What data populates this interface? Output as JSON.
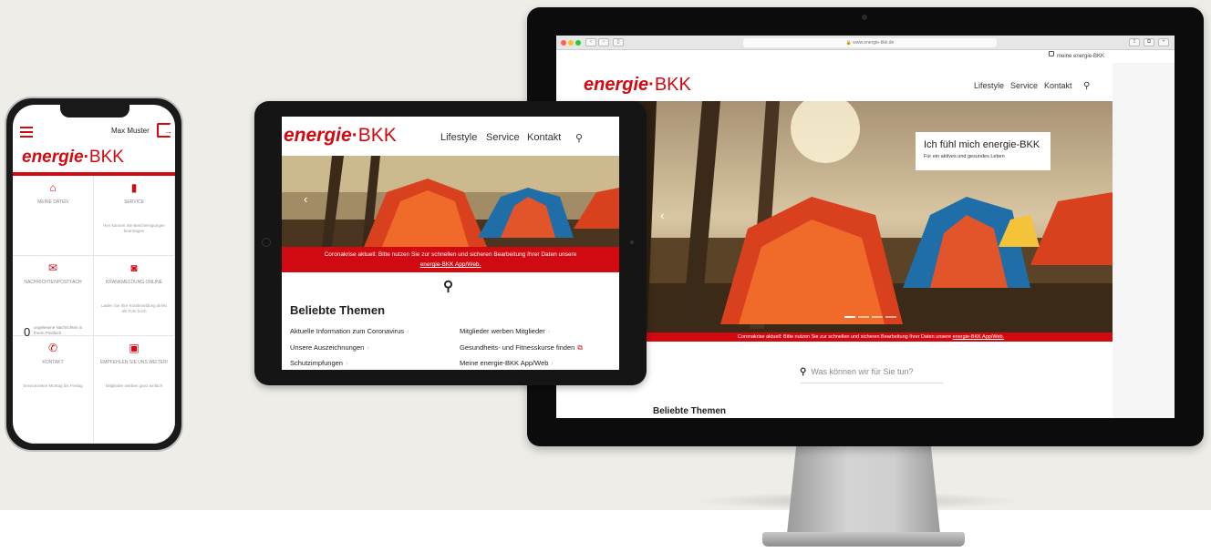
{
  "brand": {
    "logo_main": "energie",
    "logo_dot": "·",
    "logo_suffix": "BKK",
    "accent_color": "#d10a11"
  },
  "desktop": {
    "url": "🔒 www.energie-bkk.de",
    "meta_link": "meine energie-BKK",
    "nav": [
      "Lifestyle",
      "Service",
      "Kontakt"
    ],
    "search_icon": "search-icon",
    "hero_title": "Ich fühl mich energie-BKK",
    "hero_subtitle": "Für ein aktives und gesundes Leben",
    "hero_arrow": "‹",
    "notice_text": "Coronakrise aktuell: Bitte nutzen Sie zur schnellen und sicheren Bearbeitung Ihrer Daten unsere",
    "notice_link": "energie-BKK App/Web.",
    "search_placeholder": "Was können wir für Sie tun?",
    "section_title": "Beliebte Themen"
  },
  "tablet": {
    "nav": [
      "Lifestyle",
      "Service",
      "Kontakt"
    ],
    "hero_arrow": "‹",
    "notice_text": "Coronakrise aktuell: Bitte nutzen Sie zur schnellen und sicheren Bearbeitung Ihrer Daten unsere",
    "notice_link": "energie-BKK App/Web.",
    "section_title": "Beliebte Themen",
    "links": [
      "Aktuelle Information zum Coronavirus",
      "Mitglieder werben Mitglieder",
      "Unsere Auszeichnungen",
      "Gesundheits- und Fitnesskurse finden",
      "Schutzimpfungen",
      "Meine energie-BKK App/Web"
    ]
  },
  "phone": {
    "user_name": "Max Muster",
    "tiles": [
      {
        "icon": "home-icon",
        "label": "MEINE DATEN",
        "sub": ""
      },
      {
        "icon": "document-icon",
        "label": "SERVICE",
        "sub": "Hier können Sie Bescheinigungen beantragen"
      },
      {
        "icon": "mail-icon",
        "label": "NACHRICHTENPOSTFACH",
        "sub": ""
      },
      {
        "icon": "camera-icon",
        "label": "KRANKMELDUNG ONLINE",
        "sub": "Laden Sie Ihre Krankmeldung direkt als Foto hoch"
      },
      {
        "icon": "phone-icon",
        "label": "KONTAKT",
        "sub": "Servicezeiten Montag bis Freitag"
      },
      {
        "icon": "ticket-icon",
        "label": "EMPFEHLEN SIE UNS WEITER!",
        "sub": "Mitglieder werben ganz einfach"
      }
    ],
    "messages_count": "0",
    "messages_text": "ungelesene Nachrichten in Ihrem Postfach"
  }
}
